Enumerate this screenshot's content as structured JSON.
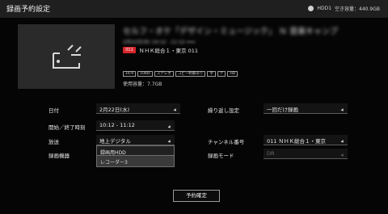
{
  "header": {
    "title": "録画予約設定",
    "hdd_label": "HDD1",
    "free_space": "空き容量：440.9GB"
  },
  "program": {
    "thumbnail_icon": "tv-placeholder-icon",
    "title": "セルフ・オケ「デザイン・ミュージック」 Ｎ 音楽キャンプ",
    "schedule": "2月22日(水) 10:12 - 11:12 ━━━",
    "channel_badge": "011",
    "channel_name": "ＮＨＫ総合１・東京 011",
    "tags": [
      "16:9",
      "1080i",
      "ステレオ",
      "コピー制御あり",
      "字",
      "デ",
      "HD"
    ],
    "usage": "使用容量：7.7GB"
  },
  "form": {
    "date": {
      "label": "日付",
      "value": "2月22日(水)"
    },
    "time": {
      "label": "開始／終了時刻",
      "value": "10:12 - 11:12"
    },
    "broadcast": {
      "label": "放送",
      "value": "地上デジタル"
    },
    "device": {
      "label": "録画機器",
      "value": "録画用HDD",
      "option": "レコーダー3"
    },
    "repeat": {
      "label": "繰り返し設定",
      "value": "一回だけ録画"
    },
    "channel": {
      "label": "チャンネル番号",
      "value": "011 ＮＨＫ総合１・東京"
    },
    "mode": {
      "label": "録画モード",
      "value": "DR"
    }
  },
  "confirm_label": "予約確定"
}
